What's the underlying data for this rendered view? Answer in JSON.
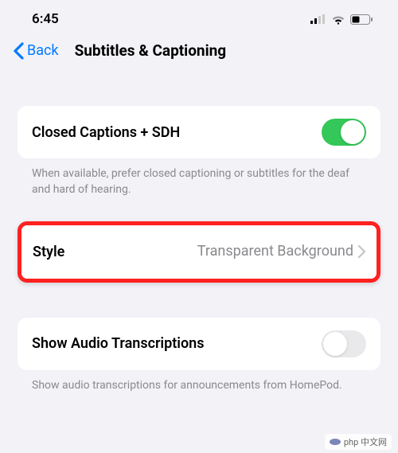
{
  "status": {
    "time": "6:45"
  },
  "nav": {
    "back": "Back",
    "title": "Subtitles & Captioning"
  },
  "closedCaptions": {
    "label": "Closed Captions + SDH",
    "toggled": true,
    "footer": "When available, prefer closed captioning or subtitles for the deaf and hard of hearing."
  },
  "style": {
    "label": "Style",
    "value": "Transparent Background"
  },
  "transcriptions": {
    "label": "Show Audio Transcriptions",
    "toggled": false,
    "footer": "Show audio transcriptions for announcements from HomePod."
  },
  "watermark": "php 中文网"
}
